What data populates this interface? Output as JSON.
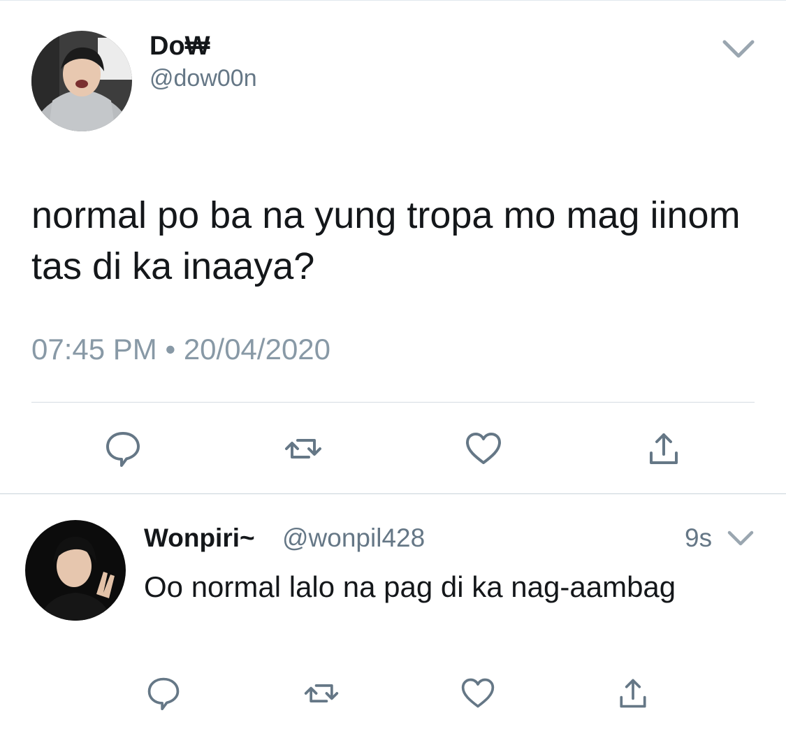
{
  "main_tweet": {
    "display_name": "Do₩",
    "handle": "@dow00n",
    "text": "normal po ba na yung tropa mo mag iinom tas di ka inaaya?",
    "timestamp": "07:45 PM • 20/04/2020",
    "avatar_icon": "profile-photo",
    "menu_icon": "chevron-down-icon"
  },
  "reply_tweet": {
    "display_name": "Wonpiri~",
    "handle": "@wonpil428",
    "time_ago": "9s",
    "text": "Oo normal lalo na pag di ka nag-aambag",
    "avatar_icon": "profile-photo",
    "menu_icon": "chevron-down-icon"
  },
  "actions": [
    "reply-icon",
    "retweet-icon",
    "like-icon",
    "share-icon"
  ],
  "colors": {
    "text": "#14171a",
    "secondary": "#657786",
    "timestamp": "#8899a6",
    "icon": "#657786",
    "divider": "#d5dde3"
  }
}
